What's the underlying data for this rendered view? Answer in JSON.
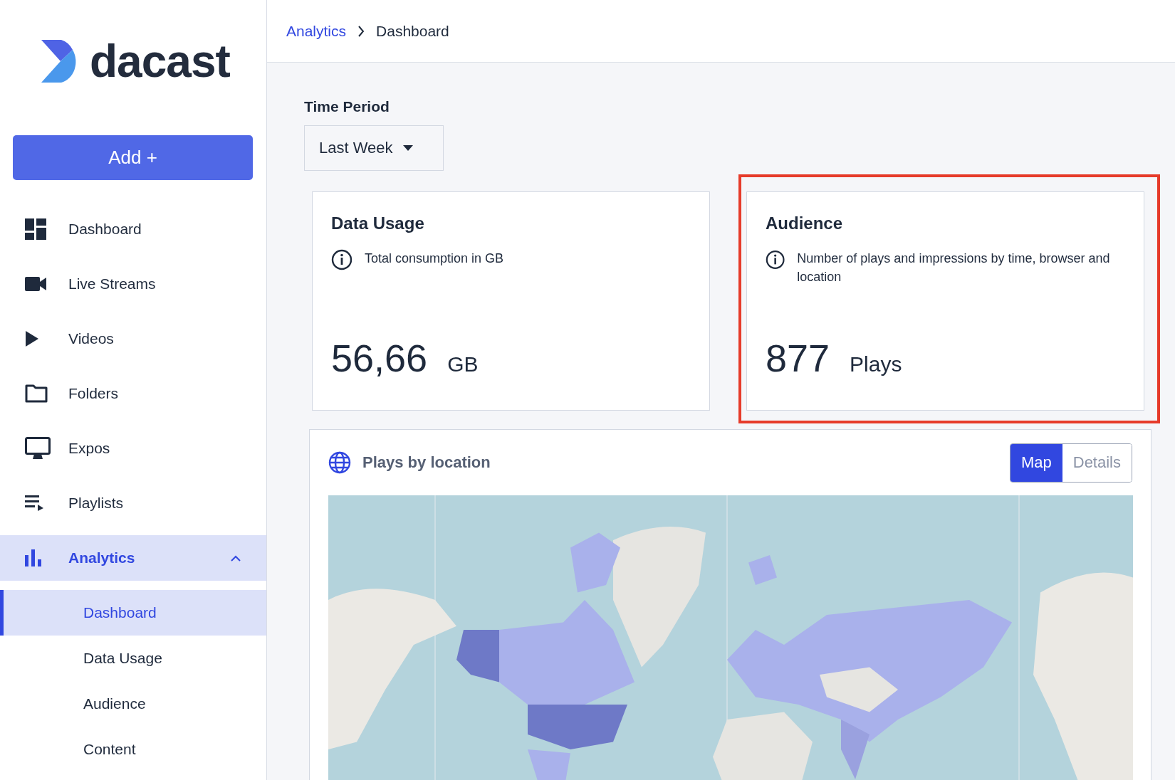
{
  "logo": {
    "wordmark": "dacast"
  },
  "add_button": {
    "label": "Add +"
  },
  "sidebar": {
    "items": [
      {
        "kind": "dashboard",
        "label": "Dashboard",
        "selected": false
      },
      {
        "kind": "camera",
        "label": "Live Streams",
        "selected": false
      },
      {
        "kind": "play",
        "label": "Videos",
        "selected": false
      },
      {
        "kind": "folder",
        "label": "Folders",
        "selected": false
      },
      {
        "kind": "monitor",
        "label": "Expos",
        "selected": false
      },
      {
        "kind": "playlist",
        "label": "Playlists",
        "selected": false
      },
      {
        "kind": "analytics",
        "label": "Analytics",
        "selected": true,
        "expanded": true,
        "children": [
          {
            "label": "Dashboard",
            "selected": true
          },
          {
            "label": "Data Usage",
            "selected": false
          },
          {
            "label": "Audience",
            "selected": false
          },
          {
            "label": "Content",
            "selected": false
          }
        ]
      }
    ]
  },
  "breadcrumb": [
    {
      "label": "Analytics",
      "link": true
    },
    {
      "label": "Dashboard",
      "link": false
    }
  ],
  "time_period": {
    "label": "Time Period",
    "value": "Last Week"
  },
  "cards": [
    {
      "title": "Data Usage",
      "info": "Total consumption in GB",
      "value": "56,66",
      "unit": "GB",
      "highlighted": false
    },
    {
      "title": "Audience",
      "info": "Number of plays and impressions by time, browser and location",
      "value": "877",
      "unit": "Plays",
      "highlighted": true
    }
  ],
  "location_panel": {
    "title": "Plays by location",
    "toggle": [
      {
        "label": "Map",
        "selected": true
      },
      {
        "label": "Details",
        "selected": false
      }
    ]
  }
}
